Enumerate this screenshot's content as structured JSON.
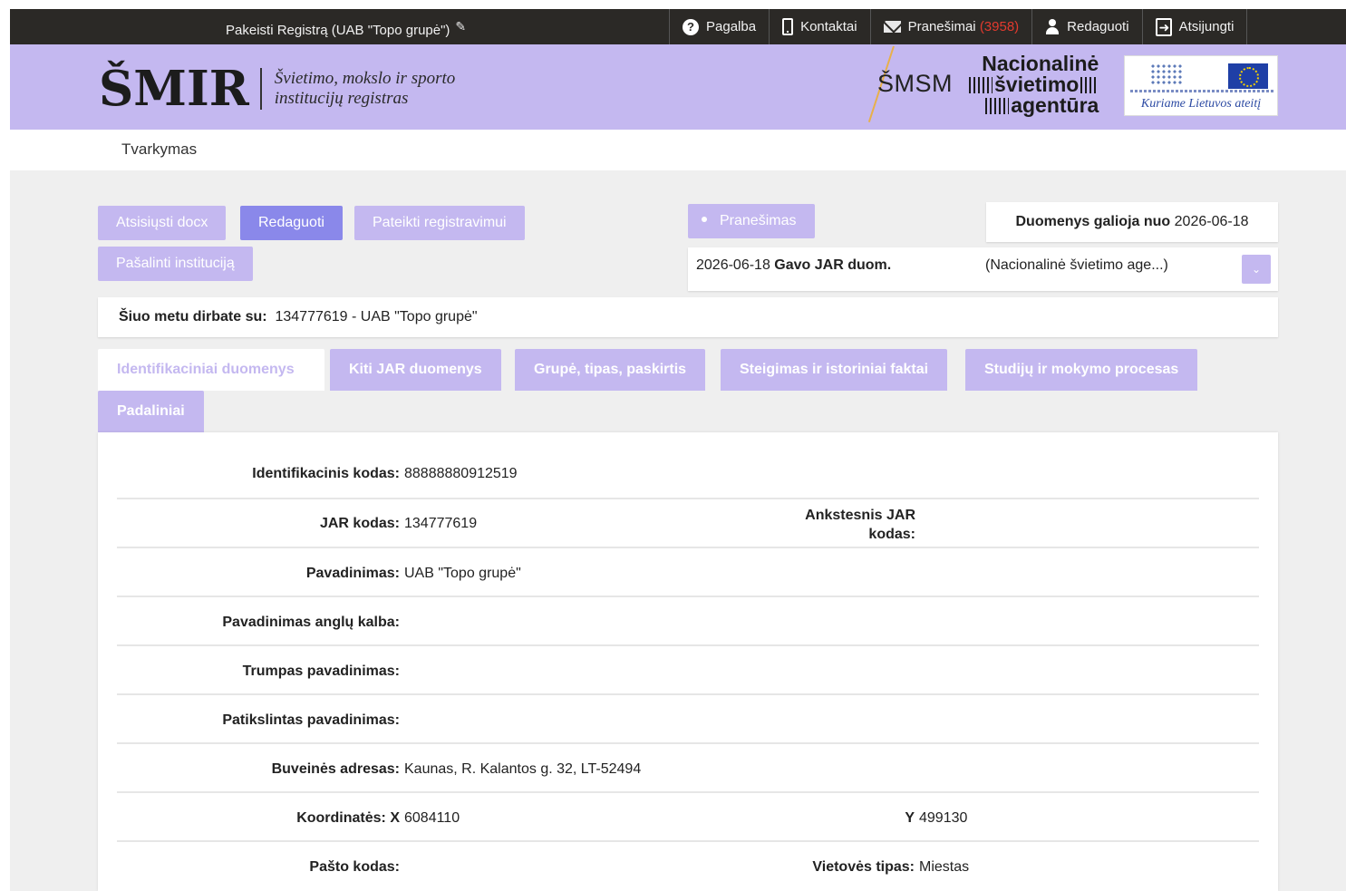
{
  "topbar": {
    "registry_label": "Pakeisti Registrą (UAB \"Topo grupė\")",
    "nav": {
      "help": "Pagalba",
      "contacts": "Kontaktai",
      "messages": "Pranešimai",
      "messages_count": "(3958)",
      "edit": "Redaguoti",
      "logout": "Atsijungti"
    }
  },
  "header": {
    "logo_mark": "ŠMIR",
    "logo_sub_line1": "Švietimo, mokslo ir sporto",
    "logo_sub_line2": "institucijų registras",
    "smsm": "ŠMSM",
    "nsa_line1": "Nacionalinė",
    "nsa_line2": "švietimo",
    "nsa_line3": "agentūra",
    "eu_motto": "Kuriame Lietuvos ateitį"
  },
  "breadcrumb": "Tvarkymas",
  "actions": {
    "download_docx": "Atsisiųsti docx",
    "edit": "Redaguoti",
    "submit": "Pateikti registravimui",
    "remove": "Pašalinti instituciją",
    "notice": "Pranešimas"
  },
  "validity": {
    "label": "Duomenys galioja nuo",
    "date": "2026-06-18"
  },
  "message": {
    "date": "2026-06-18",
    "title": "Gavo JAR duom.",
    "source": "(Nacionalinė švietimo age...)",
    "toggle": "⌄"
  },
  "working": {
    "label": "Šiuo metu dirbate su:",
    "value": "134777619  -  UAB \"Topo grupė\""
  },
  "tabs": [
    "Identifikaciniai duomenys",
    "Kiti JAR duomenys",
    "Grupė, tipas, paskirtis",
    "Steigimas ir istoriniai faktai",
    "Studijų ir mokymo procesas",
    "Padaliniai"
  ],
  "fields": {
    "id_code": {
      "label": "Identifikacinis kodas:",
      "value": "88888880912519"
    },
    "jar_code": {
      "label": "JAR kodas:",
      "value": "134777619"
    },
    "prev_jar_line1": "Ankstesnis JAR",
    "prev_jar_line2": "kodas:",
    "name": {
      "label": "Pavadinimas:",
      "value": "UAB \"Topo grupė\""
    },
    "name_en": {
      "label": "Pavadinimas anglų kalba:",
      "value": ""
    },
    "short_name": {
      "label": "Trumpas pavadinimas:",
      "value": ""
    },
    "exact_name": {
      "label": "Patikslintas pavadinimas:",
      "value": ""
    },
    "address": {
      "label": "Buveinės adresas:",
      "value": "Kaunas, R. Kalantos g. 32, LT-52494"
    },
    "coords_x": {
      "label": "Koordinatės: X",
      "value": "6084110"
    },
    "coords_y": {
      "label": "Y",
      "value": "499130"
    },
    "postal": {
      "label": "Pašto kodas:",
      "value": ""
    },
    "locality": {
      "label": "Vietovės tipas:",
      "value": "Miestas"
    }
  }
}
